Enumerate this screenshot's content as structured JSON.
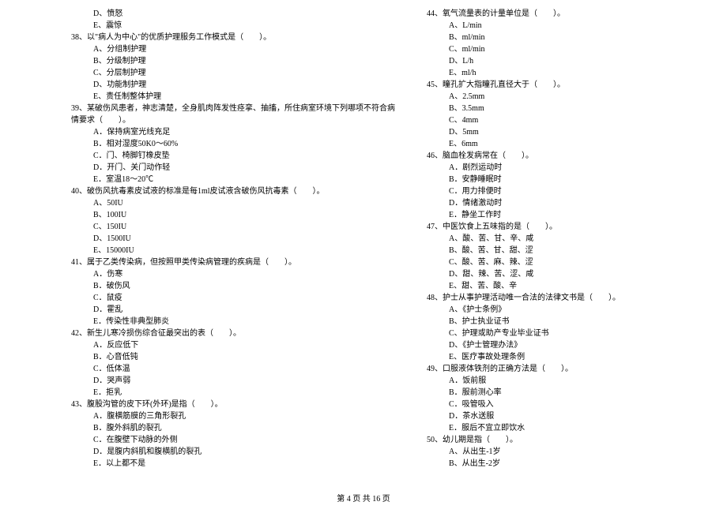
{
  "left_lines": [
    {
      "cls": "option-d",
      "text": "D、愤怒"
    },
    {
      "cls": "option-d",
      "text": "E、震惊"
    },
    {
      "cls": "question",
      "text": "38、以\"病人为中心\"的优质护理服务工作模式是（　　）。"
    },
    {
      "cls": "option",
      "text": "A、分组制护理"
    },
    {
      "cls": "option",
      "text": "B、分级制护理"
    },
    {
      "cls": "option",
      "text": "C、分层制护理"
    },
    {
      "cls": "option",
      "text": "D、功能制护理"
    },
    {
      "cls": "option",
      "text": "E、责任制整体护理"
    },
    {
      "cls": "question",
      "text": "39、某破伤风患者，神志清楚，全身肌肉阵发性痉挛、抽搐，所住病室环境下列哪项不符合病"
    },
    {
      "cls": "continuation",
      "text": "情要求（　　）。"
    },
    {
      "cls": "option",
      "text": "A．保持病室光线充足"
    },
    {
      "cls": "option",
      "text": "B．相对湿度50K0～60%"
    },
    {
      "cls": "option",
      "text": "C．门、椅脚钉橡皮垫"
    },
    {
      "cls": "option",
      "text": "D．开门、关门动作轻"
    },
    {
      "cls": "option",
      "text": "E．室温18～20℃"
    },
    {
      "cls": "question",
      "text": "40、破伤风抗毒素皮试液的标准是每1ml皮试液含破伤风抗毒素（　　）。"
    },
    {
      "cls": "option",
      "text": "A、50IU"
    },
    {
      "cls": "option",
      "text": "B、100IU"
    },
    {
      "cls": "option",
      "text": "C、150IU"
    },
    {
      "cls": "option",
      "text": "D、1500IU"
    },
    {
      "cls": "option",
      "text": "E、15000IU"
    },
    {
      "cls": "question",
      "text": "41、属于乙类传染病，但按照甲类传染病管理的疾病是（　　）。"
    },
    {
      "cls": "option",
      "text": "A．伤寒"
    },
    {
      "cls": "option",
      "text": "B．破伤风"
    },
    {
      "cls": "option",
      "text": "C．鼠疫"
    },
    {
      "cls": "option",
      "text": "D．霍乱"
    },
    {
      "cls": "option",
      "text": "E．传染性非典型肺炎"
    },
    {
      "cls": "question",
      "text": "42、新生儿寒冷损伤综合征最突出的表（　　）。"
    },
    {
      "cls": "option",
      "text": "A．反应低下"
    },
    {
      "cls": "option",
      "text": "B．心音低钝"
    },
    {
      "cls": "option",
      "text": "C．低体温"
    },
    {
      "cls": "option",
      "text": "D．哭声弱"
    },
    {
      "cls": "option",
      "text": "E．拒乳"
    },
    {
      "cls": "question",
      "text": "43、腹股沟管的皮下环(外环)是指（　　）。"
    },
    {
      "cls": "option",
      "text": "A．腹横筋膜的三角形裂孔"
    },
    {
      "cls": "option",
      "text": "B．腹外斜肌的裂孔"
    },
    {
      "cls": "option",
      "text": "C．在腹壁下动脉的外侧"
    },
    {
      "cls": "option",
      "text": "D．是腹内斜肌和腹横肌的裂孔"
    },
    {
      "cls": "option",
      "text": "E．以上都不是"
    }
  ],
  "right_lines": [
    {
      "cls": "question",
      "text": "44、氧气流量表的计量单位是（　　）。"
    },
    {
      "cls": "option",
      "text": "A、L/min"
    },
    {
      "cls": "option",
      "text": "B、ml/min"
    },
    {
      "cls": "option",
      "text": "C、ml/min"
    },
    {
      "cls": "option",
      "text": "D、L/h"
    },
    {
      "cls": "option",
      "text": "E、ml/h"
    },
    {
      "cls": "question",
      "text": "45、瞳孔扩大指瞳孔直径大于（　　）。"
    },
    {
      "cls": "option",
      "text": "A、2.5mm"
    },
    {
      "cls": "option",
      "text": "B、3.5mm"
    },
    {
      "cls": "option",
      "text": "C、4mm"
    },
    {
      "cls": "option",
      "text": "D、5mm"
    },
    {
      "cls": "option",
      "text": "E、6mm"
    },
    {
      "cls": "question",
      "text": "46、脑血栓发病常在（　　）。"
    },
    {
      "cls": "option",
      "text": "A．剧烈运动时"
    },
    {
      "cls": "option",
      "text": "B．安静睡眠时"
    },
    {
      "cls": "option",
      "text": "C．用力排便时"
    },
    {
      "cls": "option",
      "text": "D．情绪激动时"
    },
    {
      "cls": "option",
      "text": "E．静坐工作时"
    },
    {
      "cls": "question",
      "text": "47、中医饮食上五味指的是（　　）。"
    },
    {
      "cls": "option",
      "text": "A、酸、苦、甘、辛、咸"
    },
    {
      "cls": "option",
      "text": "B、酸、苦、甘、甜、涩"
    },
    {
      "cls": "option",
      "text": "C、酸、苦、麻、辣、涩"
    },
    {
      "cls": "option",
      "text": "D、甜、辣、苦、涩、咸"
    },
    {
      "cls": "option",
      "text": "E、甜、苦、酸、辛"
    },
    {
      "cls": "question",
      "text": "48、护士从事护理活动唯一合法的法律文书是（　　）。"
    },
    {
      "cls": "option",
      "text": "A、《护士条例》"
    },
    {
      "cls": "option",
      "text": "B、护士执业证书"
    },
    {
      "cls": "option",
      "text": "C、护理或助产专业毕业证书"
    },
    {
      "cls": "option",
      "text": "D、《护士管理办法》"
    },
    {
      "cls": "option",
      "text": "E、医疗事故处理条例"
    },
    {
      "cls": "question",
      "text": "49、口服液体铁剂的正确方法是（　　）。"
    },
    {
      "cls": "option",
      "text": "A．饭前服"
    },
    {
      "cls": "option",
      "text": "B．服前测心率"
    },
    {
      "cls": "option",
      "text": "C．吸管吸入"
    },
    {
      "cls": "option",
      "text": "D．茶水送服"
    },
    {
      "cls": "option",
      "text": "E．服后不宜立即饮水"
    },
    {
      "cls": "question",
      "text": "50、幼儿期是指（　　）。"
    },
    {
      "cls": "option",
      "text": "A、从出生-1岁"
    },
    {
      "cls": "option",
      "text": "B、从出生-2岁"
    }
  ],
  "footer": "第 4 页 共 16 页"
}
